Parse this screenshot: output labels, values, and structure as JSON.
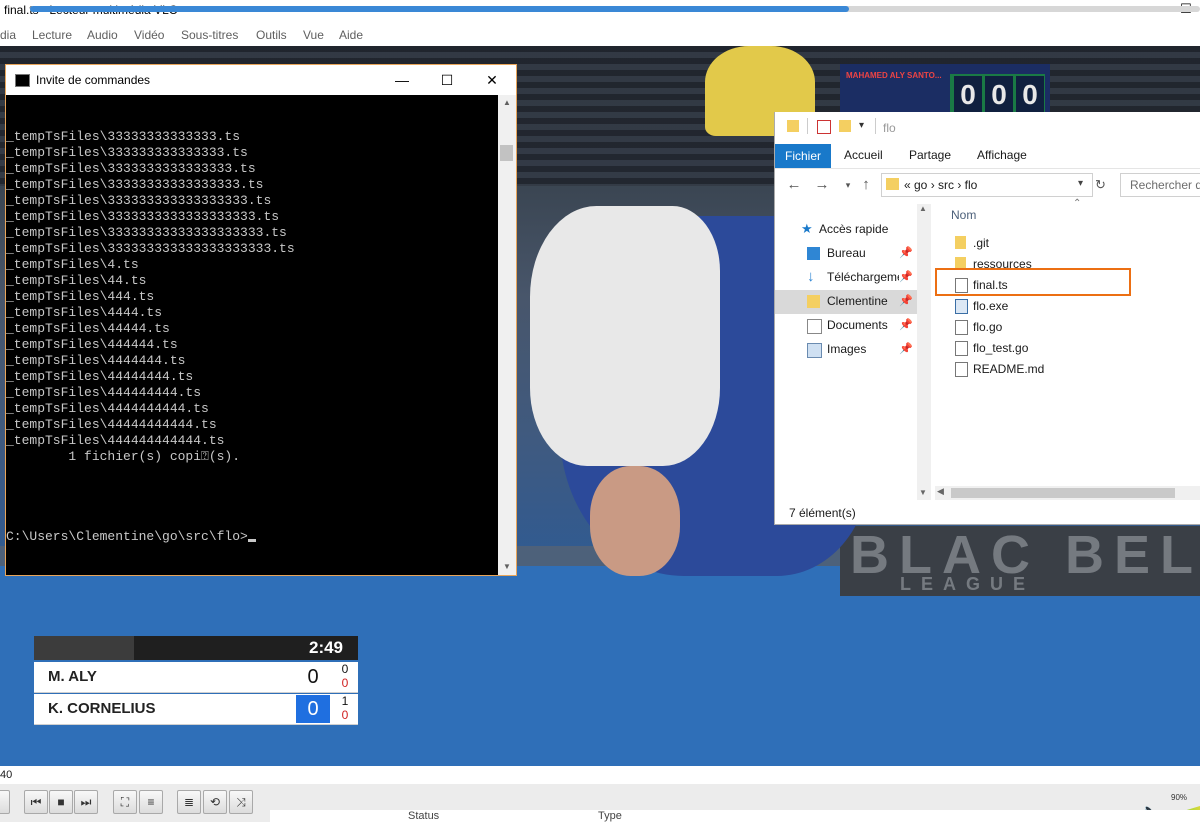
{
  "vlc": {
    "title": "final.ts - Lecteur multimédia VLC",
    "minimize_glyph": "—",
    "maximize_glyph": "☐",
    "menus": [
      "dia",
      "Lecture",
      "Audio",
      "Vidéo",
      "Sous-titres",
      "Outils",
      "Vue",
      "Aide"
    ],
    "time_left": "40",
    "progress": 0.7,
    "volume_label": "90%",
    "bottom_labels": [
      "Status",
      "Type"
    ],
    "buttons": [
      "⏮",
      "■",
      "⏭",
      "⛶",
      "≡",
      "≣",
      "⟲",
      "⤨"
    ]
  },
  "video": {
    "board_name": "MAHAMED ALY SANTO...",
    "board_digits": [
      "0",
      "0",
      "0"
    ],
    "banner_text": "BLAC BEL",
    "banner_sub": "LEAGUE"
  },
  "scoreboard": {
    "time": "2:49",
    "rows": [
      {
        "name": "M. ALY",
        "score": "0",
        "adv": "0",
        "pen": "0"
      },
      {
        "name": "K. CORNELIUS",
        "score": "0",
        "adv": "1",
        "pen": "0"
      }
    ]
  },
  "cmd": {
    "title": "Invite de commandes",
    "lines": [
      "_tempTsFiles\\33333333333333.ts",
      "_tempTsFiles\\333333333333333.ts",
      "_tempTsFiles\\3333333333333333.ts",
      "_tempTsFiles\\33333333333333333.ts",
      "_tempTsFiles\\333333333333333333.ts",
      "_tempTsFiles\\3333333333333333333.ts",
      "_tempTsFiles\\33333333333333333333.ts",
      "_tempTsFiles\\333333333333333333333.ts",
      "_tempTsFiles\\4.ts",
      "_tempTsFiles\\44.ts",
      "_tempTsFiles\\444.ts",
      "_tempTsFiles\\4444.ts",
      "_tempTsFiles\\44444.ts",
      "_tempTsFiles\\444444.ts",
      "_tempTsFiles\\4444444.ts",
      "_tempTsFiles\\44444444.ts",
      "_tempTsFiles\\444444444.ts",
      "_tempTsFiles\\4444444444.ts",
      "_tempTsFiles\\44444444444.ts",
      "_tempTsFiles\\444444444444.ts",
      "        1 fichier(s) copi⍰(s).",
      "",
      ""
    ],
    "prompt": "C:\\Users\\Clementine\\go\\src\\flo>"
  },
  "explorer": {
    "title": "flo",
    "ribbon_tabs": [
      "Fichier",
      "Accueil",
      "Partage",
      "Affichage"
    ],
    "address": "«  go  ›  src  ›  flo",
    "search_placeholder": "Rechercher da",
    "nav": [
      {
        "label": "Accès rapide",
        "icon": "star-icon",
        "pinned": false,
        "selected": false
      },
      {
        "label": "Bureau",
        "icon": "desktop-icon",
        "pinned": true,
        "selected": false
      },
      {
        "label": "Téléchargements",
        "icon": "download-icon",
        "pinned": true,
        "selected": false
      },
      {
        "label": "Clementine",
        "icon": "folder-icon",
        "pinned": true,
        "selected": true
      },
      {
        "label": "Documents",
        "icon": "documents-icon",
        "pinned": true,
        "selected": false
      },
      {
        "label": "Images",
        "icon": "images-icon",
        "pinned": true,
        "selected": false
      }
    ],
    "column_name": "Nom",
    "files": [
      {
        "name": ".git",
        "icon": "folder-icon"
      },
      {
        "name": "ressources",
        "icon": "folder-icon"
      },
      {
        "name": "final.ts",
        "icon": "file-icon"
      },
      {
        "name": "flo.exe",
        "icon": "exe-icon"
      },
      {
        "name": "flo.go",
        "icon": "file-icon"
      },
      {
        "name": "flo_test.go",
        "icon": "file-icon"
      },
      {
        "name": "README.md",
        "icon": "file-icon"
      }
    ],
    "status": "7 élément(s)"
  },
  "colors": {
    "accent_blue": "#1979ca",
    "highlight_orange": "#ec6f13",
    "seek_fill": "#3a88d6"
  }
}
